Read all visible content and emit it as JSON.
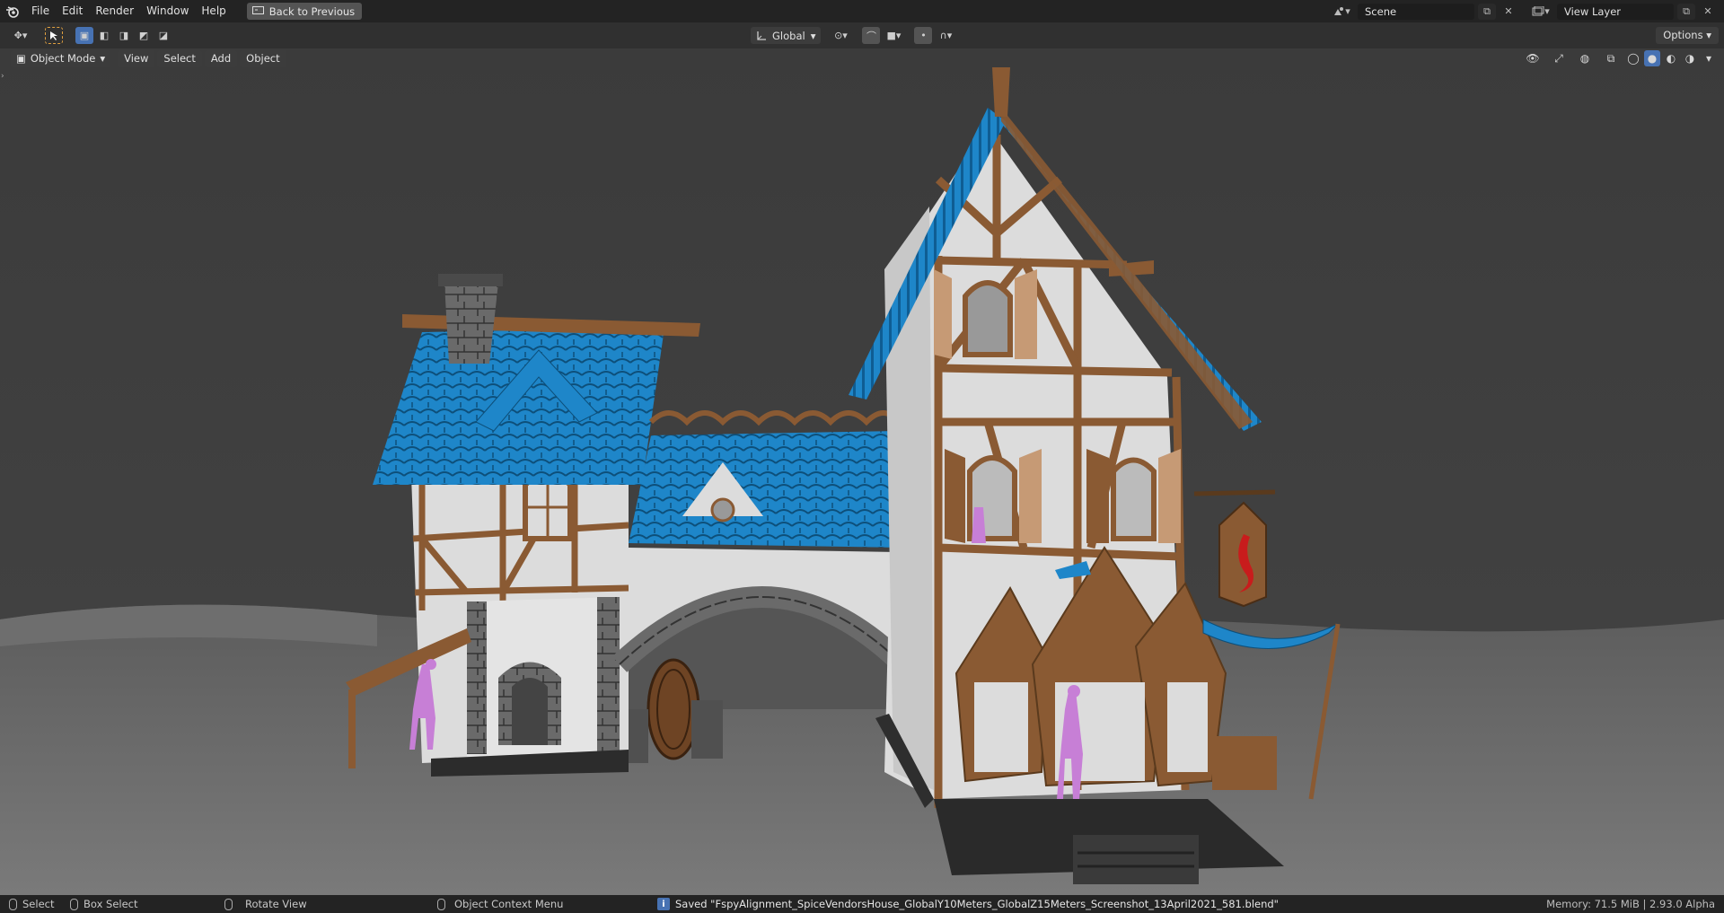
{
  "menubar": {
    "items": [
      "File",
      "Edit",
      "Render",
      "Window",
      "Help"
    ],
    "back_button": "Back to Previous",
    "scene_name": "Scene",
    "view_layer": "View Layer"
  },
  "toolheader": {
    "transform_orientation": "Global",
    "options_label": "Options"
  },
  "viewport": {
    "mode": "Object Mode",
    "menus": [
      "View",
      "Select",
      "Add",
      "Object"
    ]
  },
  "statusbar": {
    "select": "Select",
    "box_select": "Box Select",
    "rotate_view": "Rotate View",
    "context_menu": "Object Context Menu",
    "saved_message": "Saved \"FspyAlignment_SpiceVendorsHouse_GlobalY10Meters_GlobalZ15Meters_Screenshot_13April2021_581.blend\"",
    "memory": "Memory: 71.5 MiB | 2.93.0 Alpha"
  },
  "colors": {
    "accent": "#4772b3",
    "roof_blue": "#1e86c9",
    "timber_brown": "#8a5a33",
    "wall_white": "#dcdcdc"
  }
}
